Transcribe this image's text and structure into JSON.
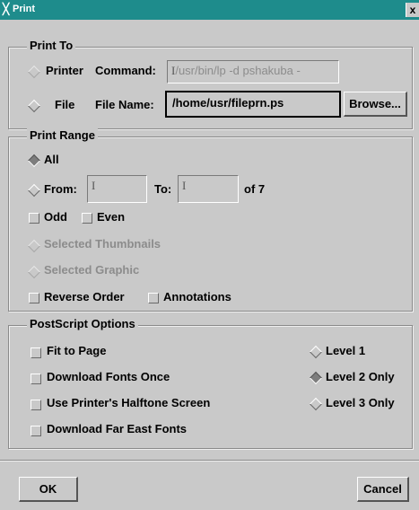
{
  "window": {
    "title": "Print",
    "close_glyph": "x"
  },
  "print_to": {
    "legend": "Print To",
    "printer": {
      "label": "Printer",
      "command_label": "Command:",
      "command_value": "/usr/bin/lp -d pshakuba -",
      "selected": false,
      "enabled": false
    },
    "file": {
      "label": "File",
      "filename_label": "File Name:",
      "filename_value": "/home/usr/fileprn.ps",
      "selected": false
    },
    "browse_label": "Browse..."
  },
  "print_range": {
    "legend": "Print Range",
    "all_label": "All",
    "all_selected": true,
    "from_label": "From:",
    "from_value": "",
    "to_label": "To:",
    "to_value": "",
    "of_label": "of 7",
    "odd_label": "Odd",
    "even_label": "Even",
    "selected_thumbnails_label": "Selected Thumbnails",
    "selected_graphic_label": "Selected Graphic",
    "reverse_order_label": "Reverse Order",
    "annotations_label": "Annotations"
  },
  "postscript": {
    "legend": "PostScript Options",
    "fit_to_page_label": "Fit to Page",
    "download_fonts_once_label": "Download Fonts Once",
    "use_halftone_label": "Use Printer's Halftone Screen",
    "download_far_east_label": "Download Far East Fonts",
    "level1_label": "Level 1",
    "level2_label": "Level 2 Only",
    "level3_label": "Level 3 Only",
    "selected_level": "Level 2 Only"
  },
  "buttons": {
    "ok_label": "OK",
    "cancel_label": "Cancel"
  },
  "colors": {
    "titlebar": "#1e8c8c",
    "background": "#c9c9c9"
  }
}
